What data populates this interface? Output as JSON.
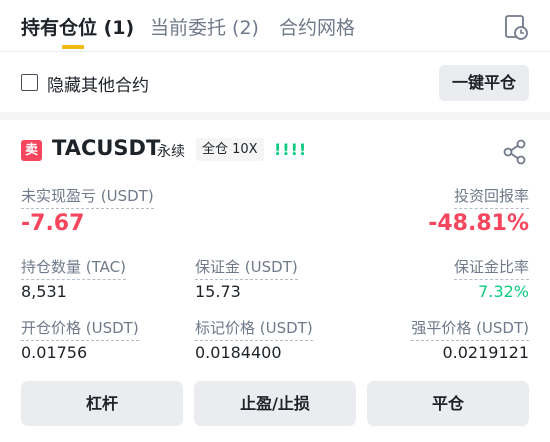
{
  "tabs": [
    {
      "label": "持有仓位 (1)",
      "active": true
    },
    {
      "label": "当前委托 (2)",
      "active": false
    },
    {
      "label": "合约网格",
      "active": false
    }
  ],
  "toolbar": {
    "hide_other_label": "隐藏其他合约",
    "hide_other_checked": false,
    "close_all_label": "一键平仓"
  },
  "position": {
    "side_badge": "卖",
    "symbol": "TACUSDT",
    "contract_type": "永续",
    "margin_leverage": "全仓 10X",
    "signal": "!!!!",
    "unrealized_pnl": {
      "label": "未实现盈亏 (USDT)",
      "value": "-7.67"
    },
    "roe": {
      "label": "投资回报率",
      "value": "-48.81%"
    },
    "size": {
      "label": "持仓数量 (TAC)",
      "value": "8,531"
    },
    "margin": {
      "label": "保证金 (USDT)",
      "value": "15.73"
    },
    "margin_ratio": {
      "label": "保证金比率",
      "value": "7.32%"
    },
    "entry_price": {
      "label": "开仓价格 (USDT)",
      "value": "0.01756"
    },
    "mark_price": {
      "label": "标记价格 (USDT)",
      "value": "0.0184400"
    },
    "liq_price": {
      "label": "强平价格 (USDT)",
      "value": "0.0219121"
    }
  },
  "actions": {
    "leverage_label": "杠杆",
    "tpsl_label": "止盈/止损",
    "close_label": "平仓"
  },
  "colors": {
    "accent": "#f0b90b",
    "negative": "#f6465d",
    "positive": "#0ecb81"
  },
  "icons": {
    "history": "history-icon",
    "share": "share-icon",
    "checkbox": "checkbox"
  }
}
